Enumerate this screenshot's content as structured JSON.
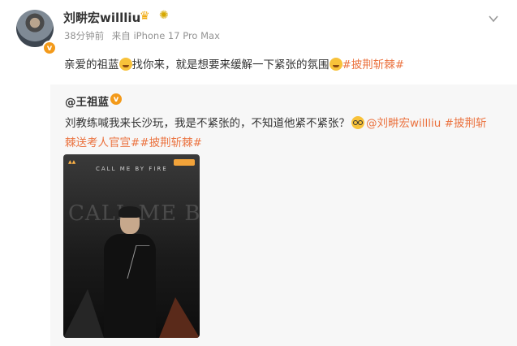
{
  "post": {
    "username": "刘畊宏willliu",
    "time_ago": "38分钟前",
    "source": "来自 iPhone 17 Pro Max",
    "text_before_emoji": "亲爱的祖蓝",
    "text_after_emoji": "找你来，就是想要来缓解一下紧张的氛围",
    "hashtag": "#披荆斩棘#"
  },
  "repost": {
    "username": "@王祖蓝",
    "line1": "刘教练喊我来长沙玩，我是不紧张的，不知道他紧不紧张？",
    "mention": "@刘畊宏willliu",
    "hashtag1_part1": "#披荆斩",
    "hashtag1_part2": "棘送考人官宣#",
    "hashtag2": "#披荆斩棘#",
    "poster": {
      "title": "CALL ME BY FIRE",
      "top_text": "CALL ME BY FIRE"
    }
  },
  "icons": {
    "verified_badge": "verified-v-icon",
    "crown": "crown-icon",
    "sun": "sun-badge-icon",
    "menu": "chevron-down-icon"
  },
  "colors": {
    "accent": "#eb7340",
    "badge": "#f39a1a",
    "meta": "#939393",
    "repost_bg": "#f7f7f7"
  }
}
